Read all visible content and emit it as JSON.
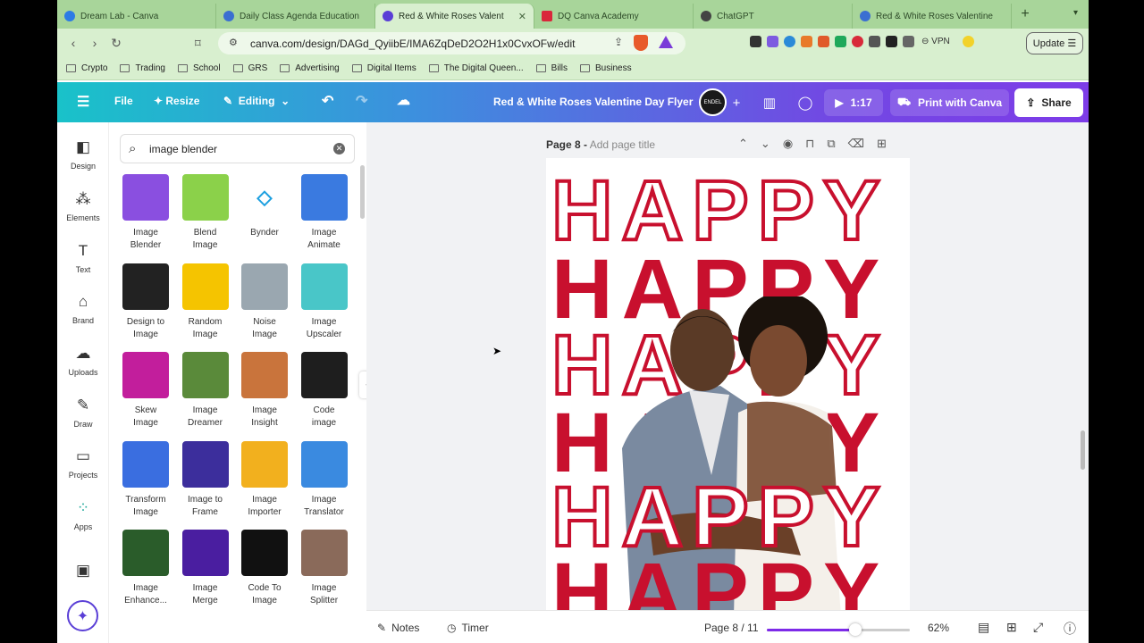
{
  "browser": {
    "tabs": [
      {
        "title": "Dream Lab - Canva",
        "color": "#2c7be5"
      },
      {
        "title": "Daily Class Agenda Education",
        "color": "#3b6fd1"
      },
      {
        "title": "Red & White Roses Valent",
        "color": "#5a3fd6"
      },
      {
        "title": "DQ Canva Academy",
        "color": "#d9263b"
      },
      {
        "title": "ChatGPT",
        "color": "#444444"
      },
      {
        "title": "Red & White Roses Valentine",
        "color": "#3b6fd1"
      }
    ],
    "url": "canva.com/design/DAGd_QyiibE/IMA6ZqDeD2O2H1x0CvxOFw/edit",
    "vpn_label": "VPN",
    "update_label": "Update",
    "bookmarks": [
      "Crypto",
      "Trading",
      "School",
      "GRS",
      "Advertising",
      "Digital Items",
      "The Digital Queen...",
      "Bills",
      "Business"
    ]
  },
  "header": {
    "file": "File",
    "resize": "Resize",
    "editing": "Editing",
    "title": "Red & White Roses Valentine Day Flyer",
    "play_time": "1:17",
    "print": "Print with Canva",
    "share": "Share",
    "accent": "#7d3ce8"
  },
  "rail": [
    {
      "label": "Design",
      "icon": "design-icon"
    },
    {
      "label": "Elements",
      "icon": "elements-icon"
    },
    {
      "label": "Text",
      "icon": "text-icon"
    },
    {
      "label": "Brand",
      "icon": "brand-icon"
    },
    {
      "label": "Uploads",
      "icon": "uploads-icon"
    },
    {
      "label": "Draw",
      "icon": "draw-icon"
    },
    {
      "label": "Projects",
      "icon": "projects-icon"
    },
    {
      "label": "Apps",
      "icon": "apps-icon"
    }
  ],
  "search": {
    "value": "image blender"
  },
  "apps": [
    {
      "line1": "Image",
      "line2": "Blender",
      "color": "#8a4fe0"
    },
    {
      "line1": "Blend",
      "line2": "Image",
      "color": "#8bd14a"
    },
    {
      "line1": "Bynder",
      "line2": "",
      "color": "#ffffff"
    },
    {
      "line1": "Image",
      "line2": "Animate",
      "color": "#3a7ae0"
    },
    {
      "line1": "Design to",
      "line2": "Image",
      "color": "#222222"
    },
    {
      "line1": "Random",
      "line2": "Image",
      "color": "#f5c400"
    },
    {
      "line1": "Noise",
      "line2": "Image",
      "color": "#9aa7b0"
    },
    {
      "line1": "Image",
      "line2": "Upscaler",
      "color": "#49c6c8"
    },
    {
      "line1": "Skew",
      "line2": "Image",
      "color": "#c21e9c"
    },
    {
      "line1": "Image",
      "line2": "Dreamer",
      "color": "#5a8a3a"
    },
    {
      "line1": "Image",
      "line2": "Insight",
      "color": "#c9743c"
    },
    {
      "line1": "Code",
      "line2": "image",
      "color": "#1e1e1e"
    },
    {
      "line1": "Transform",
      "line2": "Image",
      "color": "#3a6ee0"
    },
    {
      "line1": "Image to",
      "line2": "Frame",
      "color": "#3c2e9c"
    },
    {
      "line1": "Image",
      "line2": "Importer",
      "color": "#f2b01e"
    },
    {
      "line1": "Image",
      "line2": "Translator",
      "color": "#3a8ae0"
    },
    {
      "line1": "Image",
      "line2": "Enhance...",
      "color": "#2a5c2a"
    },
    {
      "line1": "Image",
      "line2": "Merge",
      "color": "#4a1ea0"
    },
    {
      "line1": "Code To",
      "line2": "Image",
      "color": "#111111"
    },
    {
      "line1": "Image",
      "line2": "Splitter",
      "color": "#8a6a5a"
    }
  ],
  "canvas": {
    "page_prefix": "Page 8 -",
    "page_title_placeholder": "Add page title",
    "headline": "HAPPY",
    "text_color": "#c8102e"
  },
  "footer": {
    "notes": "Notes",
    "timer": "Timer",
    "page_count": "Page 8 / 11",
    "zoom": "62%",
    "zoom_fraction": 0.62
  },
  "icons": {
    "bynder": "Bynder logo",
    "random_image": "dice"
  }
}
